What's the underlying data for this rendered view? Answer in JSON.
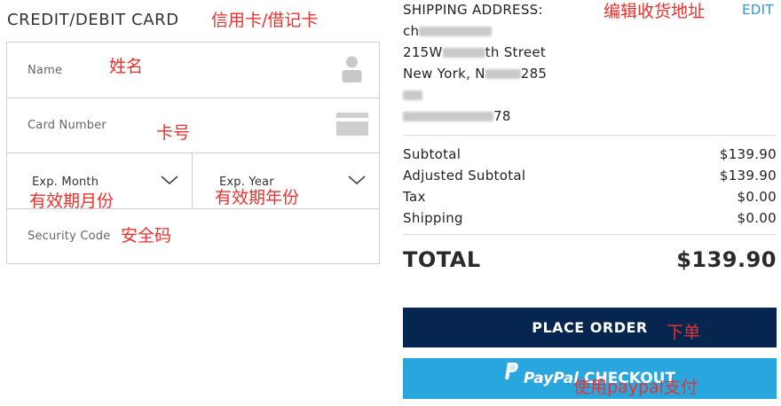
{
  "card_section": {
    "heading": "CREDIT/DEBIT CARD",
    "name_label": "Name",
    "card_number_label": "Card Number",
    "exp_month_label": "Exp. Month",
    "exp_year_label": "Exp. Year",
    "security_code_label": "Security Code"
  },
  "shipping": {
    "label": "SHIPPING ADDRESS:",
    "edit_label": "EDIT",
    "name_visible": "ch",
    "street_prefix": "215W",
    "street_suffix": "th Street",
    "city_prefix": "New York, N",
    "city_suffix": "285",
    "phone_suffix": "78"
  },
  "summary": {
    "rows": [
      {
        "label": "Subtotal",
        "value": "$139.90"
      },
      {
        "label": "Adjusted Subtotal",
        "value": "$139.90"
      },
      {
        "label": "Tax",
        "value": "$0.00"
      },
      {
        "label": "Shipping",
        "value": "$0.00"
      }
    ],
    "total_label": "TOTAL",
    "total_value": "$139.90"
  },
  "buttons": {
    "place_order": "PLACE ORDER",
    "paypal_brand": "PayPal",
    "paypal_checkout": "CHECKOUT"
  },
  "annotations": {
    "card_heading": "信用卡/借记卡",
    "name": "姓名",
    "card_number": "卡号",
    "exp_month": "有效期月份",
    "exp_year": "有效期年份",
    "security_code": "安全码",
    "edit_address": "编辑收货地址",
    "place_order": "下单",
    "paypal": "使用paypal支付"
  },
  "icons": {
    "name_field": "person-icon",
    "card_field": "credit-card-icon",
    "exp_month": "chevron-down-icon",
    "exp_year": "chevron-down-icon",
    "paypal": "paypal-logo-icon"
  },
  "colors": {
    "place_order_bg": "#06264f",
    "paypal_bg": "#29a6de",
    "edit_link": "#2f97d3",
    "annotation": "#e8322f"
  }
}
